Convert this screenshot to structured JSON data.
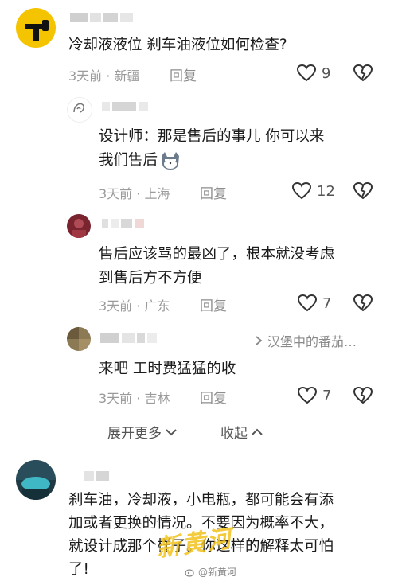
{
  "comments": [
    {
      "text": "冷却液液位 刹车油液位如何检查?",
      "time": "3天前",
      "location": "新疆",
      "reply_label": "回复",
      "likes": "9"
    }
  ],
  "replies": [
    {
      "text_line1": "设计师：那是售后的事儿 你可以来",
      "text_line2": "我们售后",
      "time": "3天前",
      "location": "上海",
      "reply_label": "回复",
      "likes": "12"
    },
    {
      "text_line1": "售后应该骂的最凶了，根本就没考虑",
      "text_line2": "到售后方不方便",
      "time": "3天前",
      "location": "广东",
      "reply_label": "回复",
      "likes": "7"
    },
    {
      "reply_to": "汉堡中的番茄…",
      "text_line1": "来吧 工时费猛猛的收",
      "time": "3天前",
      "location": "吉林",
      "reply_label": "回复",
      "likes": "7"
    }
  ],
  "controls": {
    "expand_more": "展开更多",
    "collapse": "收起"
  },
  "last_comment": {
    "line1": "刹车油，冷却液，小电瓶，都可能会有添",
    "line2": "加或者更换的情况。不要因为概率不大，",
    "line3": "就设计成那个样子。你这样的解释太可怕",
    "line4": "了!"
  },
  "watermark": {
    "logo_text": "新黄河",
    "small_text": "@新黄河"
  },
  "colors": {
    "meta_gray": "#9b9b9b",
    "text_dark": "#1b1b1b",
    "watermark_yellow": "#f2c21c"
  },
  "icons": [
    "heart-outline-icon",
    "broken-heart-icon",
    "chevron-down-icon",
    "chevron-up-icon",
    "cat-emoji-icon",
    "reply-arrow-icon"
  ]
}
